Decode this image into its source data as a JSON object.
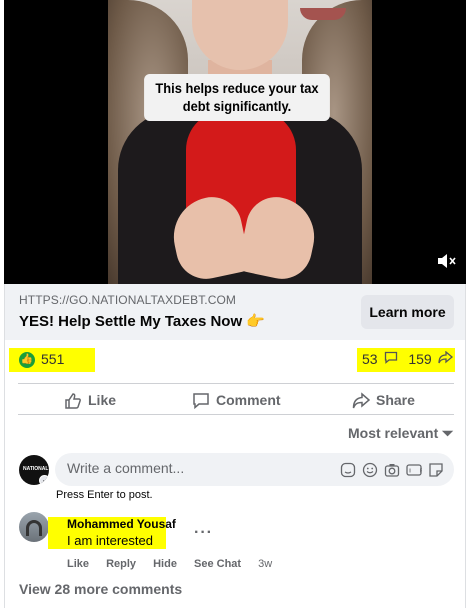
{
  "video": {
    "caption": "This helps reduce your tax debt significantly.",
    "mute_icon": "volume-muted-icon"
  },
  "link": {
    "domain": "HTTPS://GO.NATIONALTAXDEBT.COM",
    "title": "YES! Help Settle My Taxes Now 👉",
    "cta": "Learn more"
  },
  "reactions": {
    "like_count": "551",
    "comment_count": "53",
    "share_count": "159",
    "highlight_color": "#ffff00",
    "like_badge_color": "#1a9e3a"
  },
  "actions": {
    "like": "Like",
    "comment": "Comment",
    "share": "Share"
  },
  "sort": {
    "label": "Most relevant ⏷"
  },
  "composer": {
    "avatar_text": "NATIONAL",
    "placeholder": "Write a comment...",
    "hint": "Press Enter to post.",
    "icons": [
      "sticker-icon",
      "emoji-icon",
      "camera-icon",
      "gif-icon",
      "sticker-face-icon"
    ]
  },
  "comments": [
    {
      "name": "Mohammed Yousaf",
      "text": "I am interested",
      "like": "Like",
      "reply": "Reply",
      "hide": "Hide",
      "see_chat": "See Chat",
      "time": "3w"
    }
  ],
  "view_more": "View 28 more comments"
}
